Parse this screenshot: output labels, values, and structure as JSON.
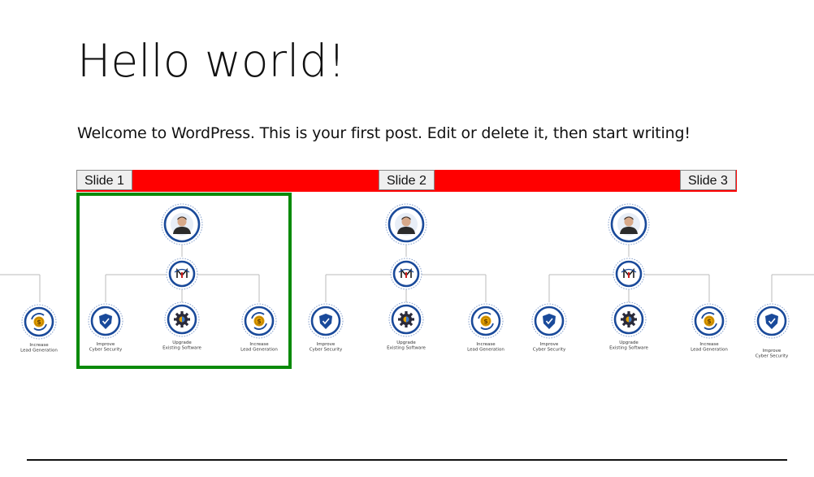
{
  "post": {
    "title": "Hello world!",
    "body": "Welcome to WordPress. This is your first post. Edit or delete it, then start writing!"
  },
  "slider": {
    "tabs": [
      {
        "label": "Slide 1"
      },
      {
        "label": "Slide 2"
      },
      {
        "label": "Slide 3"
      }
    ],
    "bar_color": "#ff0000",
    "active_border_color": "#0a8a0a"
  },
  "org_chart": {
    "labels": {
      "cyber_line1": "Improve",
      "cyber_line2": "Cyber Security",
      "upgrade_line1": "Upgrade",
      "upgrade_line2": "Existing Software",
      "lead_line1": "Increase",
      "lead_line2": "Lead Generation"
    },
    "icons": {
      "top": "person-avatar-icon",
      "middle": "company-logo-icon",
      "cyber": "shield-check-icon",
      "upgrade": "gear-icon",
      "lead": "dollar-coin-icon"
    },
    "colors": {
      "ring": "#1a4a9a",
      "gold": "#e5a100",
      "line": "#bbbbbb"
    }
  }
}
